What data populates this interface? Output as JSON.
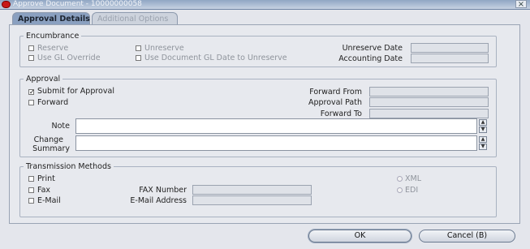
{
  "window": {
    "title": "Approve Document - 10000000058",
    "close_glyph": "×"
  },
  "tabs": [
    {
      "label": "Approval Details",
      "active": true
    },
    {
      "label": "Additional Options",
      "active": false
    }
  ],
  "encumbrance": {
    "title": "Encumbrance",
    "reserve": "Reserve",
    "use_gl_override": "Use GL Override",
    "unreserve": "Unreserve",
    "use_document_gl_date": "Use Document GL Date to Unreserve",
    "unreserve_date_label": "Unreserve Date",
    "accounting_date_label": "Accounting Date",
    "unreserve_date_value": "",
    "accounting_date_value": ""
  },
  "approval": {
    "title": "Approval",
    "submit_for_approval": "Submit for Approval",
    "submit_checked": true,
    "forward": "Forward",
    "forward_from_label": "Forward From",
    "approval_path_label": "Approval Path",
    "forward_to_label": "Forward To",
    "note_label": "Note",
    "change_summary_label_1": "Change",
    "change_summary_label_2": "Summary",
    "note_value": "",
    "change_summary_value": ""
  },
  "transmission": {
    "title": "Transmission Methods",
    "print": "Print",
    "fax": "Fax",
    "email": "E-Mail",
    "fax_number_label": "FAX Number",
    "email_address_label": "E-Mail Address",
    "xml": "XML",
    "edi": "EDI"
  },
  "buttons": {
    "ok": "OK",
    "cancel": "Cancel (B)"
  },
  "colors": {
    "accent": "#8aa0c0",
    "title_icon": "#c71818"
  }
}
